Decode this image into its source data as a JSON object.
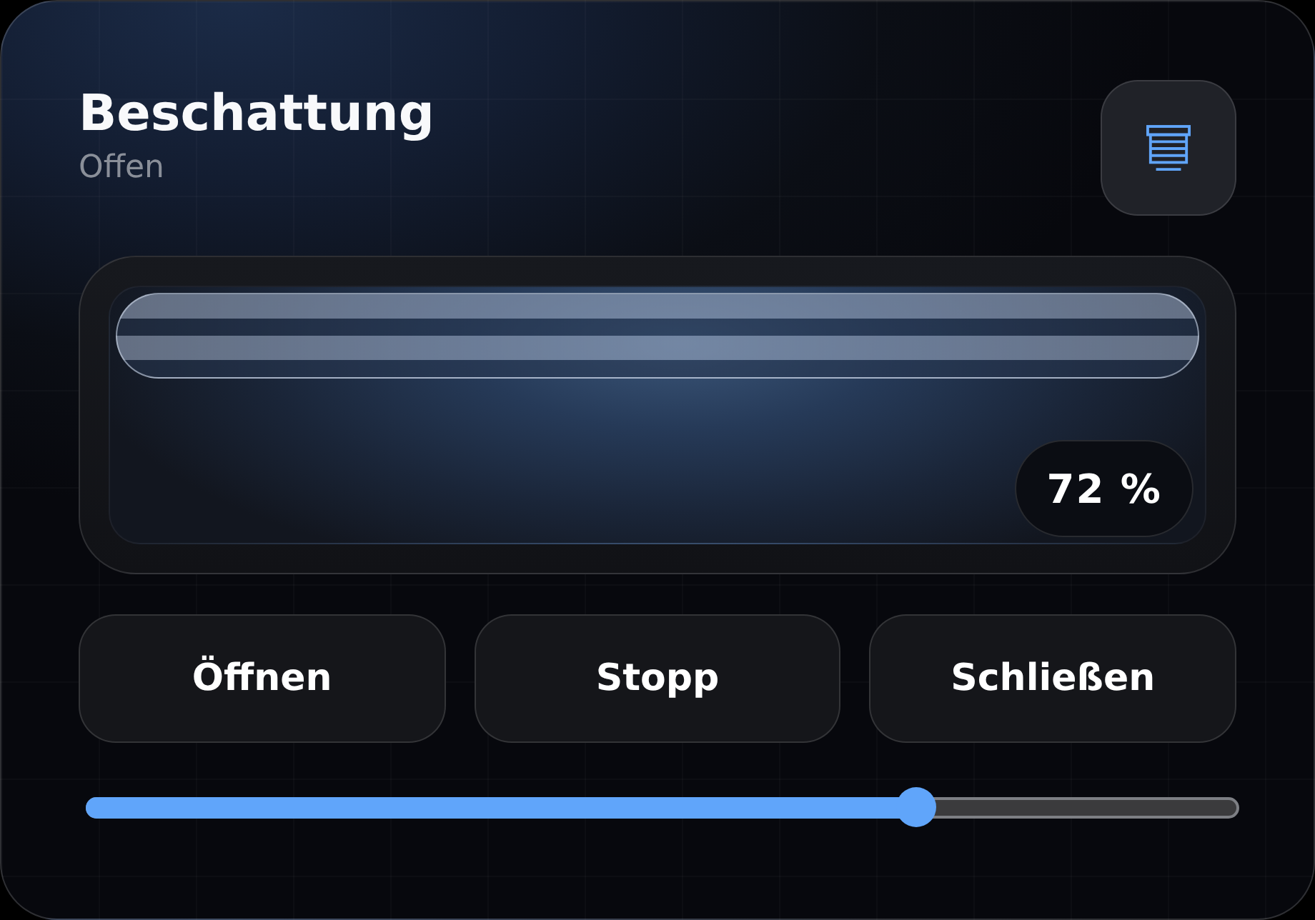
{
  "header": {
    "title": "Beschattung",
    "status": "Offen"
  },
  "preview": {
    "reading": "72 %"
  },
  "buttons": [
    {
      "label": "Öffnen"
    },
    {
      "label": "Stopp"
    },
    {
      "label": "Schließen"
    }
  ],
  "slider": {
    "level": 0.72
  }
}
